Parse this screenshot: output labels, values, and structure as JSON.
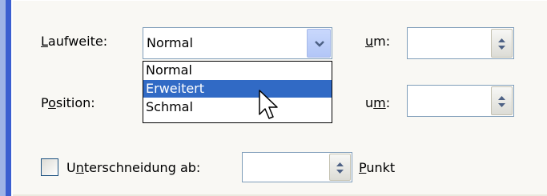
{
  "laufweite": {
    "label_underline": "L",
    "label_rest": "aufweite:",
    "value": "Normal",
    "options": [
      "Normal",
      "Erweitert",
      "Schmal"
    ],
    "selected_option": "Erweitert"
  },
  "position": {
    "label_pre": "P",
    "label_underline": "o",
    "label_rest": "sition:"
  },
  "um1": {
    "label_underline": "u",
    "label_rest": "m:",
    "value": ""
  },
  "um2": {
    "label_pre": "u",
    "label_underline": "m",
    "label_rest": ":",
    "value": ""
  },
  "kerning": {
    "label_pre": "U",
    "label_underline": "n",
    "label_rest": "terschneidung ab:",
    "value": "",
    "checked": false
  },
  "punkt": {
    "label_underline": "P",
    "label_rest": "unkt"
  },
  "icons": {
    "dropdown": "chevron-down-icon",
    "spin": "spin-up-down-icon",
    "cursor": "mouse-pointer-icon"
  },
  "colors": {
    "selection": "#316ac5",
    "border": "#7f9db9"
  }
}
